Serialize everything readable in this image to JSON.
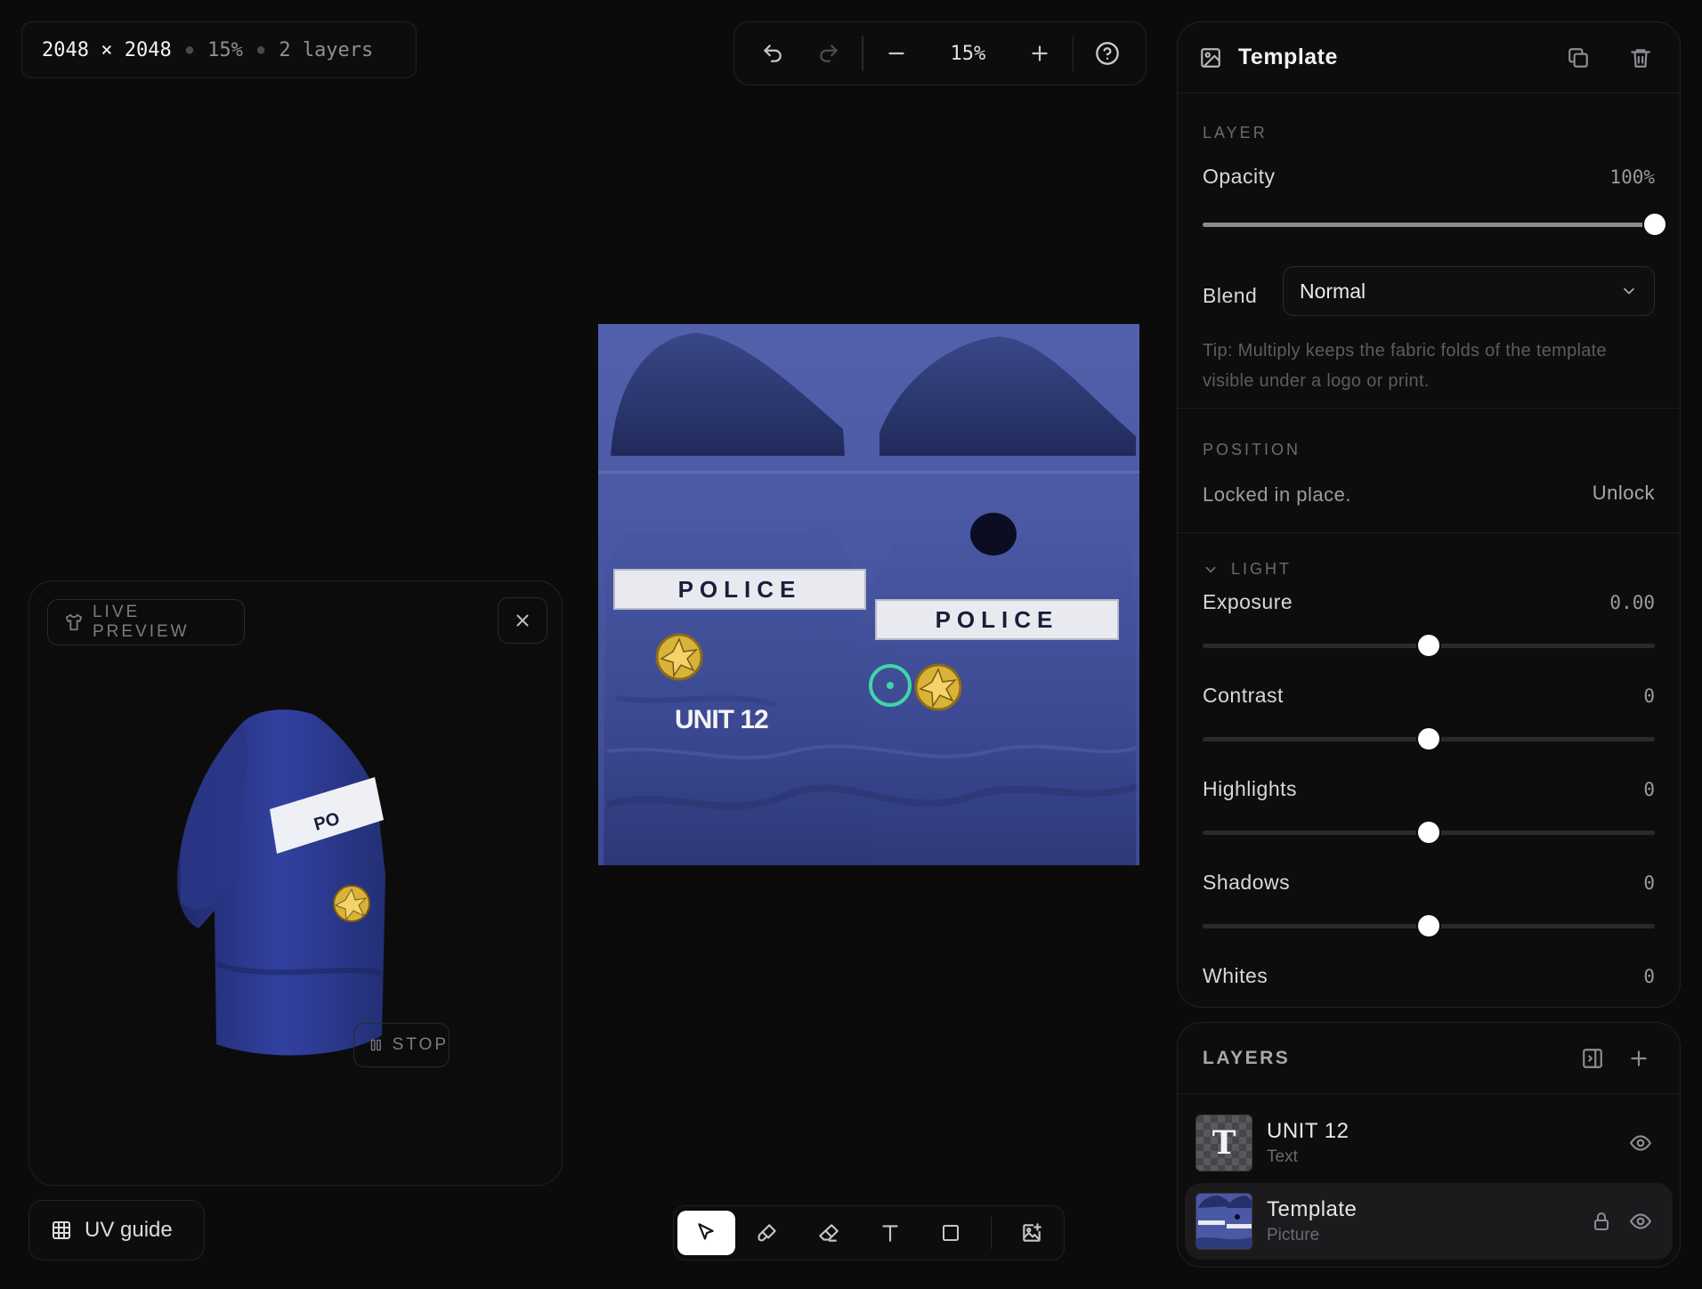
{
  "doc_info": {
    "dimensions": "2048 × 2048",
    "zoom": "15%",
    "layers_count": "2 layers"
  },
  "toolbar": {
    "zoom_value": "15%",
    "icons": [
      "undo-icon",
      "redo-icon",
      "zoom-out-icon",
      "zoom-in-icon",
      "help-icon"
    ]
  },
  "canvas": {
    "texture_color": "#4c5aa8",
    "police_text_left": "POLICE",
    "police_text_right": "POLICE",
    "unit_text": "UNIT 12",
    "badge_color": "#d9b23a",
    "target_color": "#3fd6a8"
  },
  "preview": {
    "title": "LIVE PREVIEW",
    "stop_label": "STOP",
    "shirt_text": "PO"
  },
  "uv_guide": {
    "label": "UV guide"
  },
  "tools": [
    {
      "name": "select-tool",
      "active": true
    },
    {
      "name": "brush-tool",
      "active": false
    },
    {
      "name": "eraser-tool",
      "active": false
    },
    {
      "name": "text-tool",
      "active": false
    },
    {
      "name": "shape-tool",
      "active": false
    },
    {
      "name": "add-image-tool",
      "active": false
    }
  ],
  "properties": {
    "title": "Template",
    "layer_section": "LAYER",
    "opacity_label": "Opacity",
    "opacity_value": "100%",
    "opacity_fraction": 1.0,
    "blend_label": "Blend",
    "blend_value": "Normal",
    "tip": "Tip: Multiply keeps the fabric folds of the template visible under a logo or print.",
    "position_section": "POSITION",
    "position_status": "Locked in place.",
    "unlock_label": "Unlock",
    "light_section": "LIGHT",
    "light": [
      {
        "label": "Exposure",
        "value": "0.00",
        "fraction": 0.5
      },
      {
        "label": "Contrast",
        "value": "0",
        "fraction": 0.5
      },
      {
        "label": "Highlights",
        "value": "0",
        "fraction": 0.5
      },
      {
        "label": "Shadows",
        "value": "0",
        "fraction": 0.5
      },
      {
        "label": "Whites",
        "value": "0",
        "fraction": 0.5
      }
    ]
  },
  "layers": {
    "title": "LAYERS",
    "items": [
      {
        "name": "UNIT 12",
        "type": "Text",
        "selected": false,
        "locked": false
      },
      {
        "name": "Template",
        "type": "Picture",
        "selected": true,
        "locked": true
      }
    ]
  }
}
